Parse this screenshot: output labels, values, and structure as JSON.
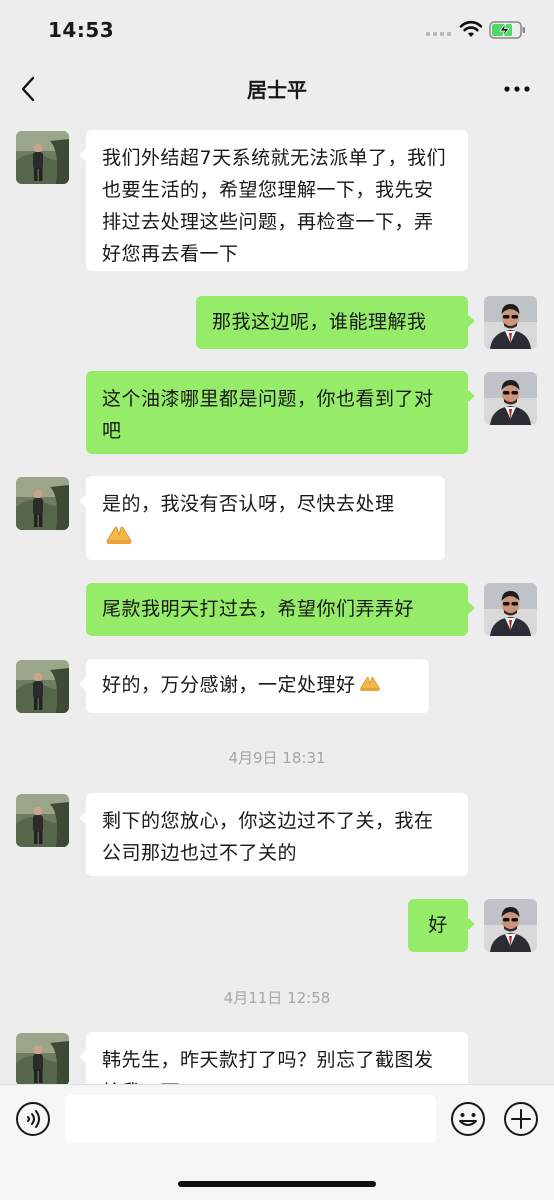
{
  "status_bar": {
    "time": "14:53"
  },
  "header": {
    "title": "居士平"
  },
  "messages": [
    {
      "side": "in",
      "text": "我们外结超7天系统就无法派单了，我们也要生活的，希望您理解一下，我先安排过去处理这些问题，再检查一下，弄好您再去看一下"
    },
    {
      "side": "out",
      "text": "那我这边呢，谁能理解我"
    },
    {
      "side": "out",
      "text": "这个油漆哪里都是问题，你也看到了对吧"
    },
    {
      "side": "in",
      "text": "是的，我没有否认呀，尽快去处理",
      "emoji": "pray-hands-icon"
    },
    {
      "side": "out",
      "text": "尾款我明天打过去，希望你们弄弄好"
    },
    {
      "side": "in",
      "text": "好的，万分感谢，一定处理好",
      "emoji": "pray-hands-icon"
    },
    {
      "side": "in",
      "text": "剩下的您放心，你这边过不了关，我在公司那边也过不了关的"
    },
    {
      "side": "out",
      "text": "好"
    },
    {
      "side": "in",
      "text": "韩先生，昨天款打了吗？别忘了截图发给我一下"
    }
  ],
  "timestamps": [
    "4月9日 18:31",
    "4月11日 12:58"
  ],
  "input_bar": {
    "placeholder": "",
    "value": ""
  },
  "icons": {
    "back": "chevron-left-icon",
    "more": "more-dots-icon",
    "voice": "voice-input-icon",
    "emoji": "emoji-icon",
    "plus": "plus-icon"
  },
  "colors": {
    "background": "#ededed",
    "outgoing_bubble": "#95ec69",
    "incoming_bubble": "#ffffff",
    "timestamp": "#a6a6a6"
  }
}
